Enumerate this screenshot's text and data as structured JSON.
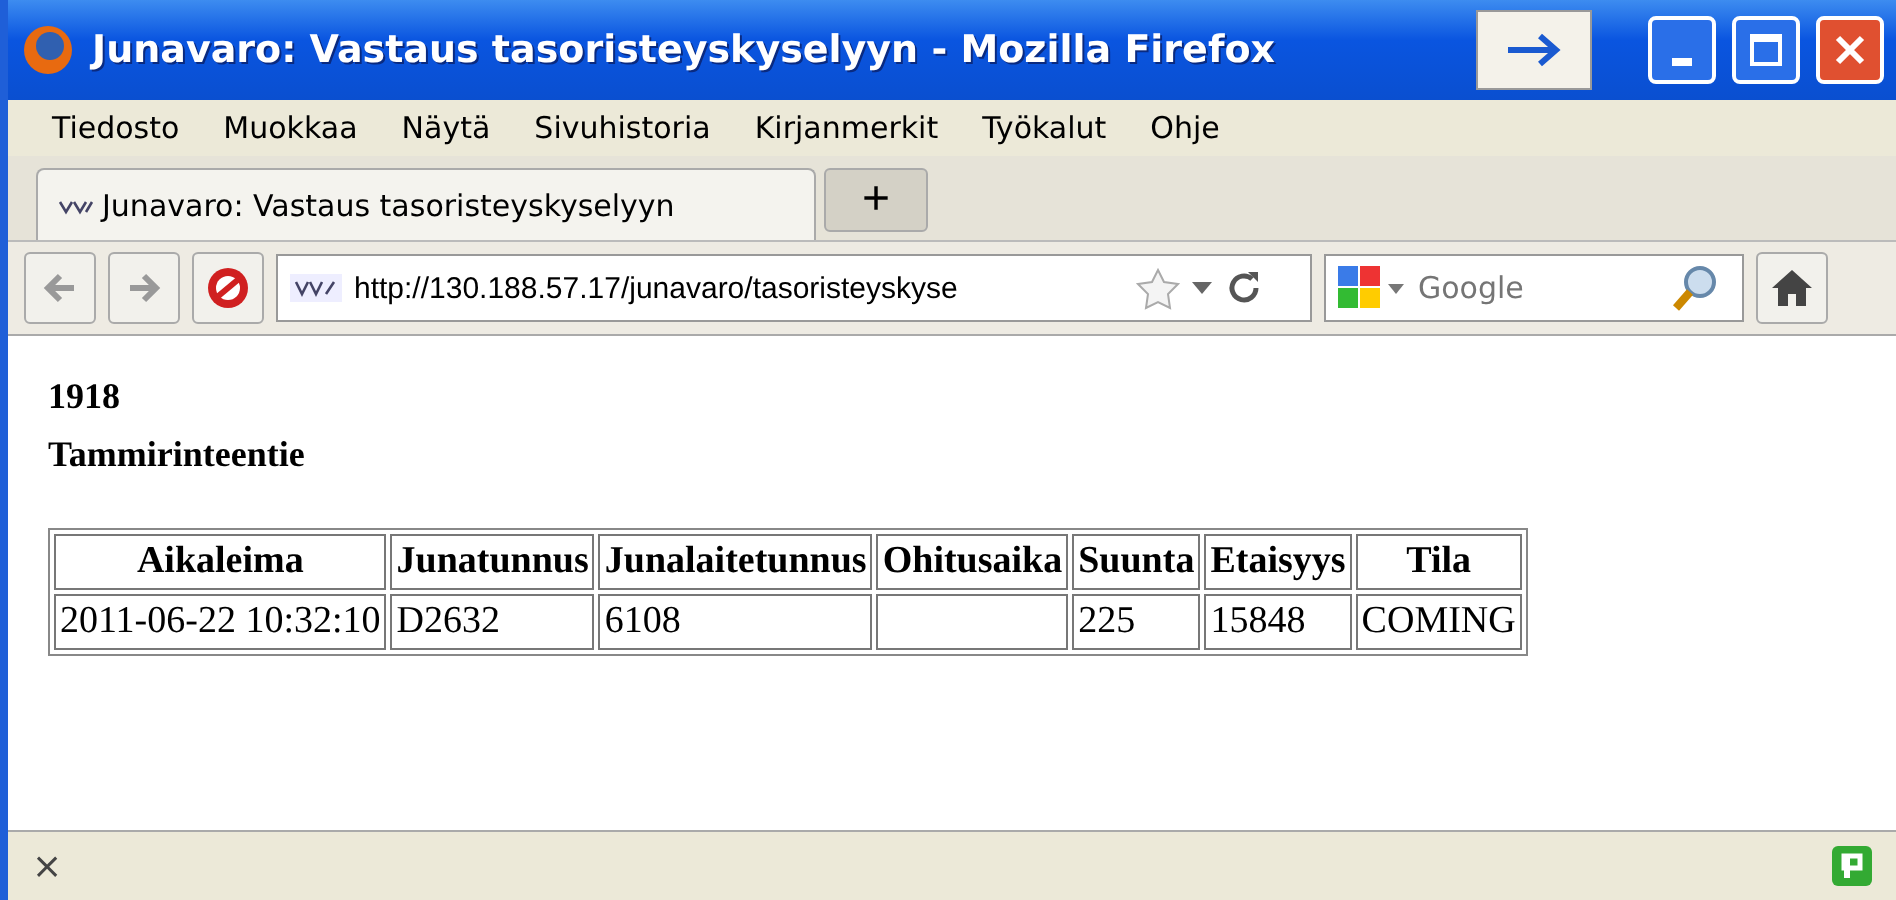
{
  "window": {
    "title": "Junavaro: Vastaus tasoristeyskyselyyn - Mozilla Firefox"
  },
  "menu": [
    "Tiedosto",
    "Muokkaa",
    "Näytä",
    "Sivuhistoria",
    "Kirjanmerkit",
    "Työkalut",
    "Ohje"
  ],
  "tabs": [
    {
      "label": "Junavaro: Vastaus tasoristeyskyselyyn",
      "selected": true
    }
  ],
  "new_tab": "+",
  "address": {
    "value": "http://130.188.57.17/junavaro/tasoristeyskyse"
  },
  "search": {
    "placeholder": "Google"
  },
  "headings": [
    "1918",
    "Tammirinteentie"
  ],
  "table": {
    "columns": [
      "Aikaleima",
      "Junatunnus",
      "Junalaitetunnus",
      "Ohitusaika",
      "Suunta",
      "Etaisyys",
      "Tila"
    ],
    "rows": [
      [
        "2011-06-22 10:32:10",
        "D2632",
        "6108",
        "",
        "225",
        "15848",
        "COMING"
      ]
    ]
  },
  "status_bar": {
    "close": "×"
  }
}
